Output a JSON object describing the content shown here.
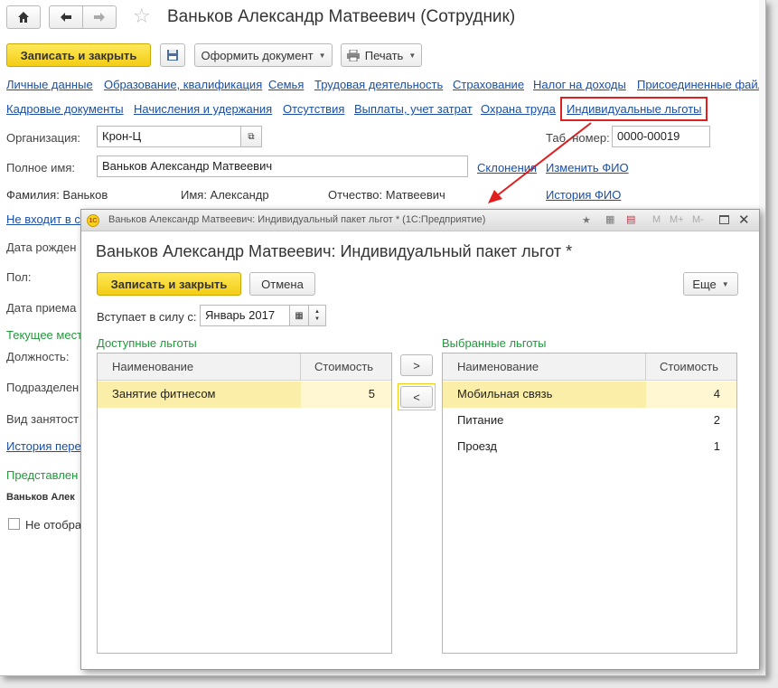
{
  "window": {
    "title": "Ваньков Александр Матвеевич (Сотрудник)",
    "save_close": "Записать и закрыть",
    "make_document": "Оформить документ",
    "print": "Печать"
  },
  "tabs_row1": [
    "Личные данные",
    "Образование, квалификация",
    "Семья",
    "Трудовая деятельность",
    "Страхование",
    "Налог на доходы",
    "Присоединенные файлы"
  ],
  "tabs_row2": [
    "Кадровые документы",
    "Начисления и удержания",
    "Отсутствия",
    "Выплаты, учет затрат",
    "Охрана труда",
    "Индивидуальные льготы"
  ],
  "form": {
    "org_label": "Организация:",
    "org_value": "Крон-Ц",
    "tab_label": "Таб. номер:",
    "tab_value": "0000-00019",
    "fullname_label": "Полное имя:",
    "fullname_value": "Ваньков Александр Матвеевич",
    "declension_link": "Склонения",
    "change_fio_link": "Изменить ФИО",
    "surname": "Фамилия: Ваньков",
    "name": "Имя: Александр",
    "patronymic": "Отчество: Матвеевич",
    "fio_history_link": "История ФИО",
    "not_in_link": "Не входит в с",
    "birth_label": "Дата рожден",
    "gender_label": "Пол:",
    "hire_label": "Дата приема",
    "current_place": "Текущее мест",
    "position_label": "Должность:",
    "department_label": "Подразделен",
    "employment_label": "Вид занятост",
    "history_link": "История пере",
    "representation": "Представлен",
    "rep_name": "Ваньков Алек",
    "not_show": "Не отобра"
  },
  "dialog": {
    "window_title": "Ваньков Александр Матвеевич: Индивидуальный пакет льгот * (1С:Предприятие)",
    "heading": "Ваньков Александр Матвеевич: Индивидуальный пакет льгот *",
    "save_close": "Записать и закрыть",
    "cancel": "Отмена",
    "more": "Еще",
    "effective_label": "Вступает в силу с:",
    "effective_value": "Январь 2017",
    "available_title": "Доступные льготы",
    "selected_title": "Выбранные льготы",
    "col_name": "Наименование",
    "col_cost": "Стоимость",
    "move_right": ">",
    "move_left": "<",
    "available": [
      {
        "name": "Занятие фитнесом",
        "cost": "5"
      }
    ],
    "selected": [
      {
        "name": "Мобильная связь",
        "cost": "4"
      },
      {
        "name": "Питание",
        "cost": "2"
      },
      {
        "name": "Проезд",
        "cost": "1"
      }
    ],
    "title_icons": [
      "М",
      "М+",
      "М-"
    ]
  },
  "colors": {
    "accent_yellow": "#f3cc14",
    "link_blue": "#1a4fa8",
    "group_green": "#1f9a3a",
    "highlight_red": "#e02020"
  }
}
